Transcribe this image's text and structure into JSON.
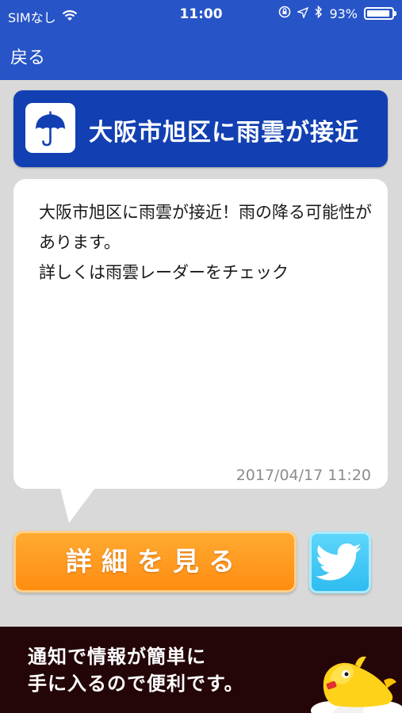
{
  "status_bar": {
    "carrier": "SIMなし",
    "time": "11:00",
    "battery": "93%",
    "battery_level": 0.93,
    "icons": [
      "wifi-icon",
      "orientation-lock-icon",
      "location-icon",
      "bluetooth-icon",
      "battery-icon"
    ]
  },
  "nav": {
    "back_label": "戻る"
  },
  "alert": {
    "icon": "umbrella-icon",
    "title": "大阪市旭区に雨雲が接近"
  },
  "message": {
    "line1": "大阪市旭区に雨雲が接近！雨の降る可能性があります。",
    "line2": "詳しくは雨雲レーダーをチェック",
    "timestamp": "2017/04/17 11:20"
  },
  "actions": {
    "detail_label": "詳細を見る",
    "share_icon": "twitter-icon"
  },
  "banner": {
    "line1": "通知で情報が簡単に",
    "line2": "手に入るので便利です。"
  },
  "colors": {
    "nav_blue": "#2754c7",
    "alert_blue": "#1240b2",
    "detail_orange": "#ff9a1f",
    "twitter_blue": "#3cc6f4",
    "banner_bg": "#240608"
  }
}
